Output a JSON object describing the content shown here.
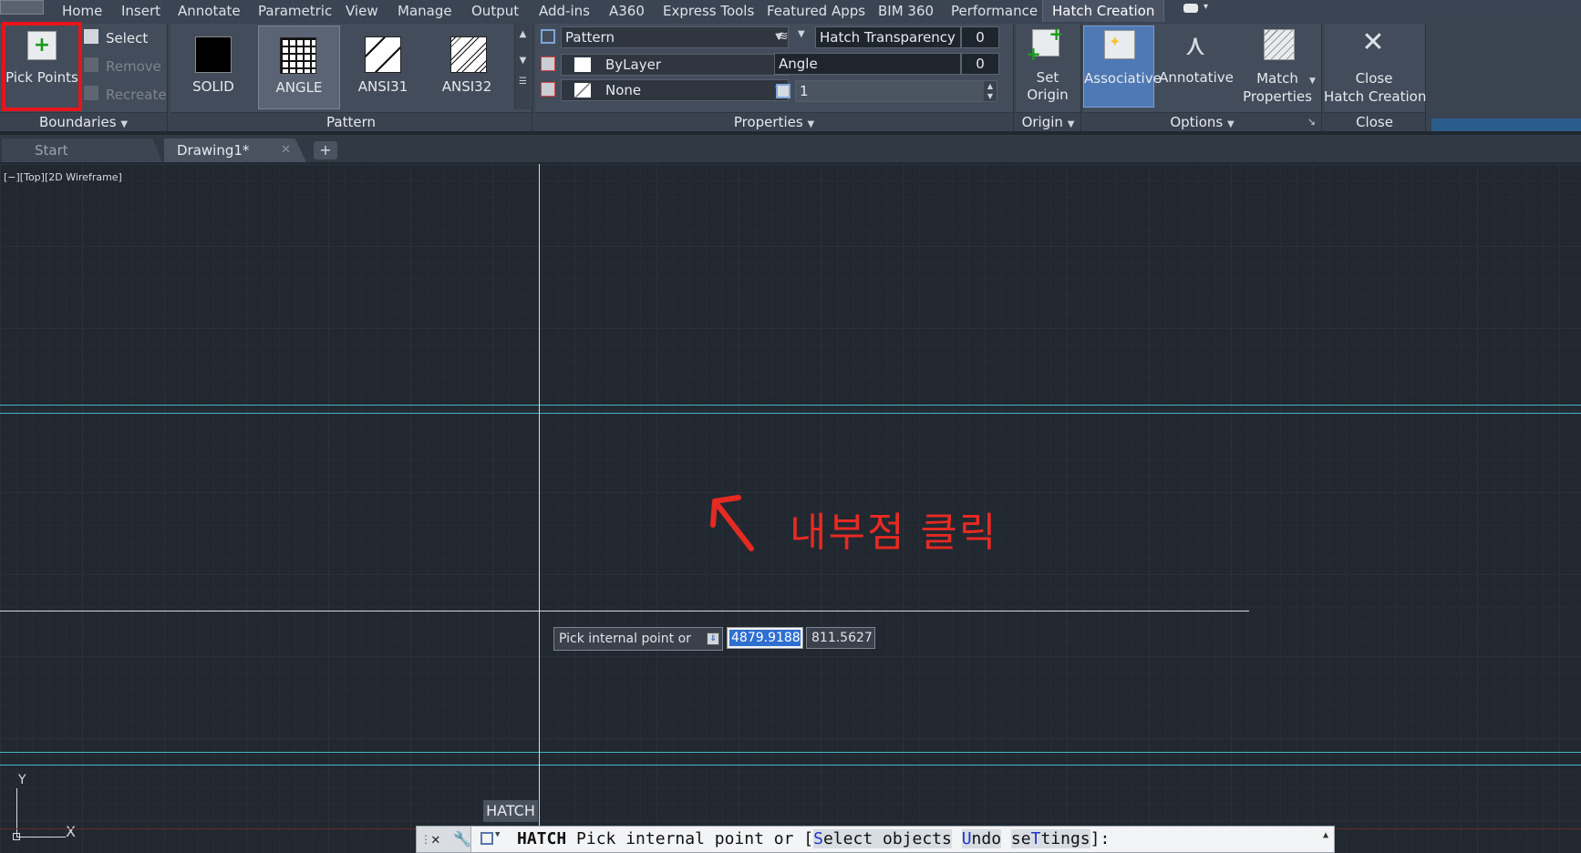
{
  "menu": {
    "tabs": [
      "Home",
      "Insert",
      "Annotate",
      "Parametric",
      "View",
      "Manage",
      "Output",
      "Add-ins",
      "A360",
      "Express Tools",
      "Featured Apps",
      "BIM 360",
      "Performance",
      "Hatch Creation"
    ],
    "active": "Hatch Creation"
  },
  "ribbon": {
    "boundaries": {
      "pick_points": "Pick Points",
      "select": "Select",
      "remove": "Remove",
      "recreate": "Recreate",
      "footer": "Boundaries"
    },
    "pattern": {
      "items": [
        "SOLID",
        "ANGLE",
        "ANSI31",
        "ANSI32"
      ],
      "selected": "ANGLE",
      "footer": "Pattern"
    },
    "properties": {
      "type_value": "Pattern",
      "color_value": "ByLayer",
      "background_value": "None",
      "transparency_label": "Hatch Transparency",
      "transparency_value": "0",
      "angle_label": "Angle",
      "angle_value": "0",
      "scale_value": "1",
      "footer": "Properties"
    },
    "origin": {
      "set_origin_line1": "Set",
      "set_origin_line2": "Origin",
      "footer": "Origin"
    },
    "options": {
      "associative": "Associative",
      "annotative": "Annotative",
      "match_line1": "Match",
      "match_line2": "Properties",
      "footer": "Options"
    },
    "close": {
      "line1": "Close",
      "line2": "Hatch Creation",
      "footer": "Close"
    }
  },
  "doctabs": {
    "start": "Start",
    "drawing": "Drawing1*"
  },
  "viewport": {
    "label": "[−][Top][2D Wireframe]"
  },
  "annotation": {
    "text": "내부점 클릭",
    "color": "#e52a22"
  },
  "tooltip": {
    "prompt": "Pick internal point or",
    "x": "4879.9188",
    "y": "811.5627"
  },
  "hatch_label": "HATCH",
  "ucs": {
    "x": "X",
    "y": "Y"
  },
  "command": {
    "prefix": "HATCH",
    "text": "Pick internal point or [",
    "opt1_key": "S",
    "opt1_rest": "elect objects",
    "opt2_key": "U",
    "opt2_rest": "ndo",
    "opt3_pre": "se",
    "opt3_key": "T",
    "opt3_rest": "tings",
    "end": "]:"
  },
  "colors": {
    "accent_red": "#e52a22",
    "cyan_lines": "#45b7c4",
    "highlight_blue": "#2f6fd0"
  }
}
